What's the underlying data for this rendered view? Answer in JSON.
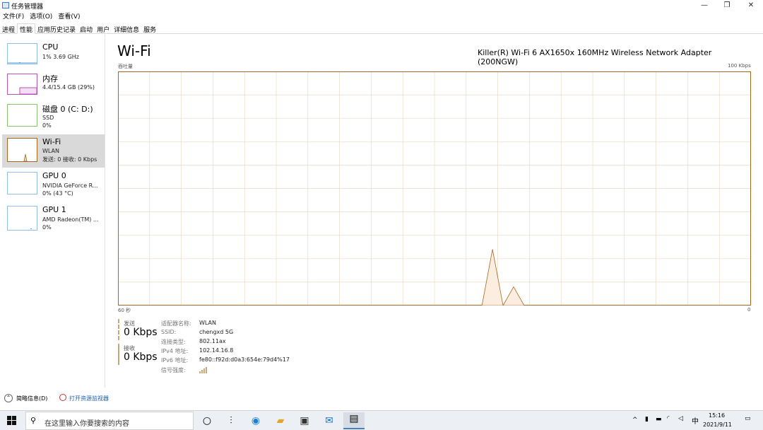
{
  "window": {
    "title": "任务管理器",
    "controls": {
      "minimize": "—",
      "maximize": "❐",
      "close": "✕"
    }
  },
  "menu": [
    "文件(F)",
    "选项(O)",
    "查看(V)"
  ],
  "tabs": [
    "进程",
    "性能",
    "应用历史记录",
    "启动",
    "用户",
    "详细信息",
    "服务"
  ],
  "active_tab": "性能",
  "sidebar": [
    {
      "title": "CPU",
      "line1": "1% 3.69 GHz",
      "line2": ""
    },
    {
      "title": "内存",
      "line1": "4.4/15.4 GB (29%)",
      "line2": ""
    },
    {
      "title": "磁盘 0 (C: D:)",
      "line1": "SSD",
      "line2": "0%"
    },
    {
      "title": "Wi-Fi",
      "line1": "WLAN",
      "line2": "发送: 0 接收: 0 Kbps"
    },
    {
      "title": "GPU 0",
      "line1": "NVIDIA GeForce R...",
      "line2": "0% (43 °C)"
    },
    {
      "title": "GPU 1",
      "line1": "AMD Radeon(TM) ...",
      "line2": "0%"
    }
  ],
  "main": {
    "title": "Wi-Fi",
    "adapter": "Killer(R) Wi-Fi 6 AX1650x 160MHz Wireless Network Adapter (200NGW)",
    "throughput_label": "吞吐量",
    "max_label": "100 Kbps",
    "x_left": "60 秒",
    "x_right": "0"
  },
  "chart_data": {
    "type": "area",
    "title": "",
    "xlabel": "",
    "ylabel": "吞吐量",
    "xlim": [
      60,
      0
    ],
    "ylim": [
      0,
      100
    ],
    "grid": true,
    "series": [
      {
        "values": [
          [
            0,
            0
          ],
          [
            60,
            0
          ],
          [
            59,
            0
          ],
          [
            58,
            0
          ],
          [
            57,
            0
          ],
          [
            56,
            0
          ],
          [
            55,
            0
          ],
          [
            54,
            0
          ],
          [
            53,
            0
          ],
          [
            52,
            0
          ],
          [
            51,
            0
          ],
          [
            50,
            0
          ],
          [
            49,
            0
          ],
          [
            48,
            0
          ],
          [
            47,
            0
          ],
          [
            46,
            0
          ],
          [
            45,
            0
          ],
          [
            44,
            0
          ],
          [
            43,
            0
          ],
          [
            42,
            0
          ],
          [
            41,
            0
          ],
          [
            40,
            0
          ],
          [
            39,
            0
          ],
          [
            38,
            0
          ],
          [
            37,
            0
          ],
          [
            36,
            0
          ],
          [
            35,
            0
          ],
          [
            34,
            0
          ],
          [
            33,
            0
          ],
          [
            32,
            0
          ],
          [
            31,
            0
          ],
          [
            30,
            0
          ],
          [
            29,
            0
          ],
          [
            28,
            0
          ],
          [
            27,
            0
          ],
          [
            26,
            0
          ],
          [
            25,
            0
          ],
          [
            24,
            0
          ],
          [
            23,
            0
          ],
          [
            22,
            0
          ],
          [
            21,
            0
          ],
          [
            20,
            0
          ],
          [
            19,
            0
          ],
          [
            18,
            0
          ],
          [
            17,
            0
          ],
          [
            16,
            0
          ],
          [
            15,
            0
          ],
          [
            14,
            0
          ],
          [
            13,
            0
          ],
          [
            12,
            0
          ],
          [
            11,
            0
          ],
          [
            10,
            0
          ],
          [
            9,
            0
          ],
          [
            8,
            0
          ],
          [
            7,
            0
          ],
          [
            6,
            0
          ],
          [
            5,
            0
          ],
          [
            4,
            0
          ],
          [
            3,
            0
          ],
          [
            2,
            0
          ],
          [
            1,
            0
          ]
        ]
      }
    ],
    "spikes": [
      {
        "x_start": 25.5,
        "x_peak": 24.5,
        "x_end": 23.5,
        "y": 24
      },
      {
        "x_start": 23.5,
        "x_peak": 22.5,
        "x_end": 21.5,
        "y": 8
      }
    ]
  },
  "stats": {
    "send": {
      "label": "发送",
      "value": "0 Kbps"
    },
    "recv": {
      "label": "接收",
      "value": "0 Kbps"
    }
  },
  "props": [
    {
      "key": "适配器名称:",
      "value": "WLAN"
    },
    {
      "key": "SSID:",
      "value": "chengxd 5G"
    },
    {
      "key": "连接类型:",
      "value": "802.11ax"
    },
    {
      "key": "IPv4 地址:",
      "value": "102.14.16.8"
    },
    {
      "key": "IPv6 地址:",
      "value": "fe80::f92d:d0a3:654e:79d4%17"
    },
    {
      "key": "信号强度:",
      "value": ""
    }
  ],
  "footer": {
    "less_details": "简略信息(D)",
    "open_monitor": "打开资源监视器"
  },
  "taskbar": {
    "search_placeholder": "在这里输入你要搜索的内容",
    "ime": "中",
    "time": "15:16",
    "date": "2021/9/11"
  },
  "colors": {
    "accent": "#a7671e",
    "grid": "#ead9c4",
    "fill": "#fbeee0",
    "selected": "#d9d9d9"
  }
}
